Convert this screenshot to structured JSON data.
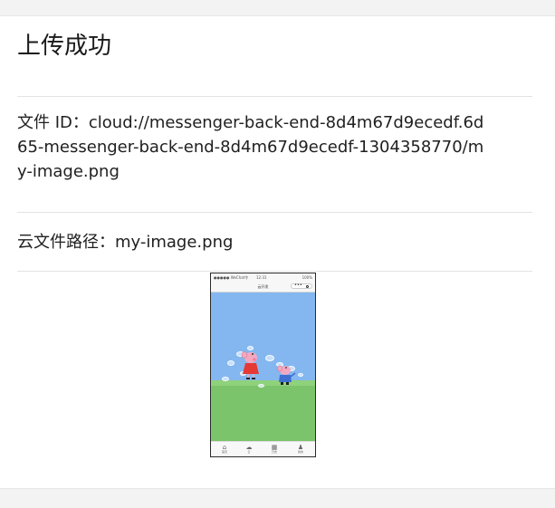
{
  "page": {
    "title": "上传成功"
  },
  "file_info": {
    "file_id_lines": [
      "文件 ID：cloud://messenger-back-end-8d4m67d9ecedf.6d",
      "65-messenger-back-end-8d4m67d9ecedf-1304358770/m",
      "y-image.png"
    ],
    "cloud_path": "云文件路径：my-image.png"
  },
  "thumbnail": {
    "status_left": "●●●●● WeChat令",
    "status_time": "12:31",
    "status_right": "100%",
    "nav_title": "云开发",
    "nav_menu": "•••",
    "tabs": [
      {
        "icon": "首页-icon",
        "label": "首页"
      },
      {
        "icon": "云-icon",
        "label": "云"
      },
      {
        "icon": "日志-icon",
        "label": "日志"
      },
      {
        "icon": "我的-icon",
        "label": "我的"
      }
    ],
    "colors": {
      "sky": "#84b7ef",
      "grass": "#7bc46b",
      "pig_pink": "#f4a8c0",
      "pig_dress": "#e53935",
      "george_shirt": "#3f6fd1"
    }
  }
}
